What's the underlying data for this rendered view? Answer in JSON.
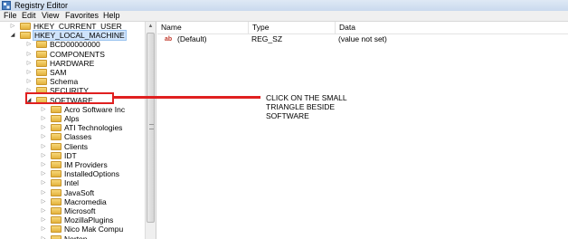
{
  "window": {
    "title": "Registry Editor"
  },
  "menu": [
    "File",
    "Edit",
    "View",
    "Favorites",
    "Help"
  ],
  "tree": [
    {
      "label": "HKEY_CURRENT_USER",
      "expanded": false,
      "level": 0
    },
    {
      "label": "HKEY_LOCAL_MACHINE",
      "expanded": true,
      "level": 0,
      "selected": true
    },
    {
      "label": "BCD00000000",
      "expanded": false,
      "level": 1
    },
    {
      "label": "COMPONENTS",
      "expanded": false,
      "level": 1
    },
    {
      "label": "HARDWARE",
      "expanded": false,
      "level": 1
    },
    {
      "label": "SAM",
      "expanded": false,
      "level": 1
    },
    {
      "label": "Schema",
      "expanded": false,
      "level": 1
    },
    {
      "label": "SECURITY",
      "expanded": false,
      "level": 1
    },
    {
      "label": "SOFTWARE",
      "expanded": true,
      "level": 1
    },
    {
      "label": "Acro Software Inc",
      "expanded": false,
      "level": 2
    },
    {
      "label": "Alps",
      "expanded": false,
      "level": 2
    },
    {
      "label": "ATI Technologies",
      "expanded": false,
      "level": 2
    },
    {
      "label": "Classes",
      "expanded": false,
      "level": 2
    },
    {
      "label": "Clients",
      "expanded": false,
      "level": 2
    },
    {
      "label": "IDT",
      "expanded": false,
      "level": 2
    },
    {
      "label": "IM Providers",
      "expanded": false,
      "level": 2
    },
    {
      "label": "InstalledOptions",
      "expanded": false,
      "level": 2
    },
    {
      "label": "Intel",
      "expanded": false,
      "level": 2
    },
    {
      "label": "JavaSoft",
      "expanded": false,
      "level": 2
    },
    {
      "label": "Macromedia",
      "expanded": false,
      "level": 2
    },
    {
      "label": "Microsoft",
      "expanded": false,
      "level": 2
    },
    {
      "label": "MozillaPlugins",
      "expanded": false,
      "level": 2
    },
    {
      "label": "Nico Mak Compu",
      "expanded": false,
      "level": 2
    },
    {
      "label": "Norton",
      "expanded": false,
      "level": 2
    }
  ],
  "list": {
    "columns": {
      "name": "Name",
      "type": "Type",
      "data": "Data"
    },
    "rows": [
      {
        "name": "(Default)",
        "type": "REG_SZ",
        "data": "(value not set)",
        "icon": "string-value-icon"
      }
    ]
  },
  "annotation": {
    "lines": [
      "CLICK ON THE SMALL",
      "TRIANGLE BESIDE",
      "SOFTWARE"
    ],
    "color": "#e02020"
  }
}
